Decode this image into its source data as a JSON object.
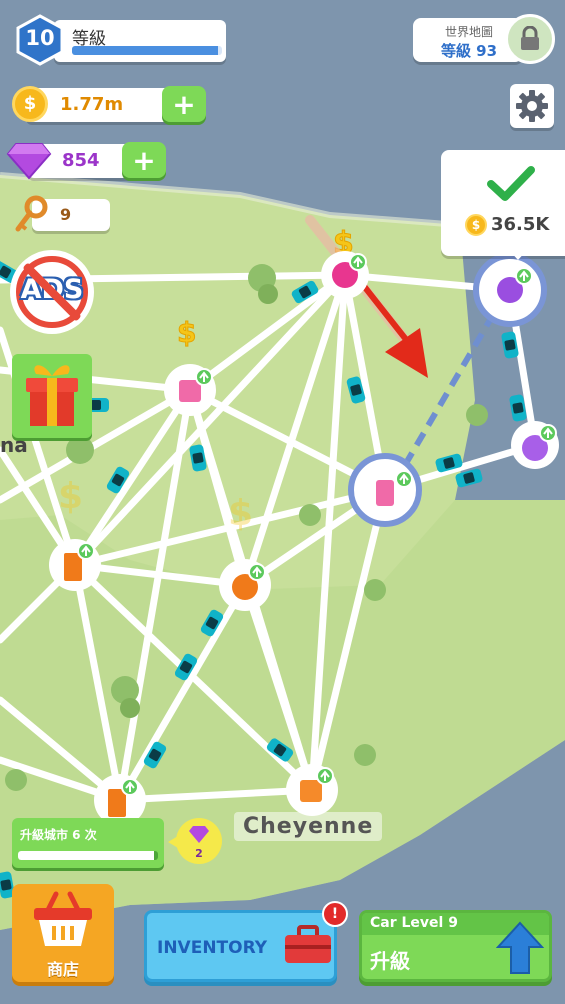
{
  "player": {
    "level": "10",
    "level_label": "等級",
    "xp_fraction": 0.97
  },
  "world_map": {
    "title": "世界地圖",
    "level_text": "等級 93"
  },
  "currency": {
    "coins": "1.77m",
    "gems": "854",
    "keys": "9"
  },
  "ads_button": {
    "label": "ADS"
  },
  "gift_partial_text": "na",
  "unlock_popup": {
    "cost": "36.5K"
  },
  "city_name": "Cheyenne",
  "city_upgrade": {
    "label": "升級城市 6 次",
    "gem_reward": "2",
    "progress": 0.97
  },
  "shop_button": {
    "label": "商店"
  },
  "inventory_button": {
    "label": "INVENTORY",
    "alert": "!"
  },
  "car_level": {
    "title": "Car Level 9",
    "action": "升級"
  },
  "colors": {
    "gold": "#f5c518",
    "grass": "#c7df9a",
    "water": "#7e95ad",
    "green_button": "#7ed957",
    "blue_arrow": "#2b7fd8"
  }
}
